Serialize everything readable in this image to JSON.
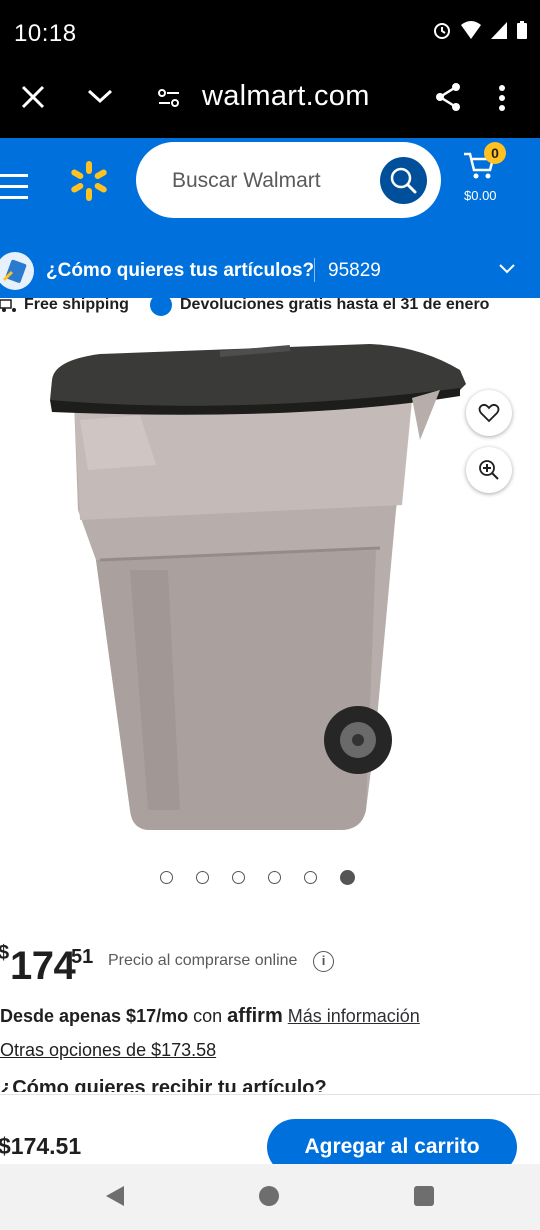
{
  "status_bar": {
    "time": "10:18"
  },
  "browser": {
    "url": "walmart.com"
  },
  "header": {
    "search_placeholder": "Buscar Walmart",
    "cart_count": "0",
    "cart_total": "$0.00",
    "brand_color": "#0071dc",
    "accent_color": "#ffc220"
  },
  "delivery": {
    "question": "¿Cómo quieres tus artículos?",
    "zip": "95829"
  },
  "promo": {
    "shipping": "Free shipping",
    "returns": "Devoluciones gratis hasta el 31 de enero"
  },
  "gallery": {
    "image_count": 6,
    "active_index": 5
  },
  "price": {
    "currency": "$",
    "whole": "174",
    "cents": "51",
    "note": "Precio al comprarse online"
  },
  "financing": {
    "prefix": "Desde apenas $17/mo",
    "connector": "con",
    "provider": "affirm",
    "link": "Más información"
  },
  "other_options": "Otras opciones de $173.58",
  "receive_heading": "¿Cómo quieres recibir tu artículo?",
  "sticky": {
    "amount": "$174.51",
    "add_to_cart": "Agregar al carrito"
  }
}
